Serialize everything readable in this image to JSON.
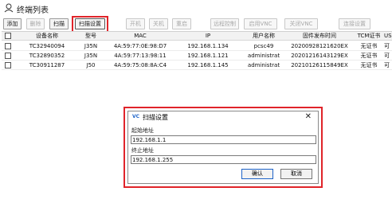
{
  "window": {
    "title": "终端列表",
    "icon": "terminal-list-icon"
  },
  "toolbar": {
    "buttons": [
      {
        "label": "添加",
        "enabled": true
      },
      {
        "label": "删除",
        "enabled": false
      },
      {
        "label": "扫描",
        "enabled": true
      },
      {
        "label": "扫描设置",
        "enabled": true,
        "highlighted": true
      },
      {
        "label": "开机",
        "enabled": false
      },
      {
        "label": "关机",
        "enabled": false
      },
      {
        "label": "重启",
        "enabled": false
      },
      {
        "label": "远程控制",
        "enabled": false
      },
      {
        "label": "启用VNC",
        "enabled": false
      },
      {
        "label": "关闭VNC",
        "enabled": false
      },
      {
        "label": "连接设置",
        "enabled": false
      }
    ]
  },
  "table": {
    "columns": [
      "设备名称",
      "型号",
      "MAC",
      "IP",
      "用户名称",
      "固件发布时间",
      "TCM证书",
      "US"
    ],
    "rows": [
      {
        "name": "TC32940094",
        "model": "J35N",
        "mac": "4A:59:77:0E:98:D7",
        "ip": "192.168.1.134",
        "user": "pcsc49",
        "firmware": "20200928121620EX",
        "tcm": "无证书",
        "us": "可"
      },
      {
        "name": "TC32890352",
        "model": "J35N",
        "mac": "4A:59:77:13:98:11",
        "ip": "192.168.1.121",
        "user": "administrat",
        "firmware": "20201216143129EX",
        "tcm": "无证书",
        "us": "可"
      },
      {
        "name": "TC30911287",
        "model": "J50",
        "mac": "4A:59:75:08:8A:C4",
        "ip": "192.168.1.145",
        "user": "administrat",
        "firmware": "20210126115849EX",
        "tcm": "无证书",
        "us": "可"
      }
    ]
  },
  "dialog": {
    "title": "扫描设置",
    "icon": "vnc-icon",
    "icon_text": "VC",
    "close_symbol": "✕",
    "start_label": "起始地址",
    "start_value": "192.168.1.1",
    "end_label": "终止地址",
    "end_value": "192.168.1.255",
    "ok_label": "确认",
    "cancel_label": "取消"
  },
  "colors": {
    "highlight": "#e0242a",
    "accent": "#1e63c8"
  }
}
